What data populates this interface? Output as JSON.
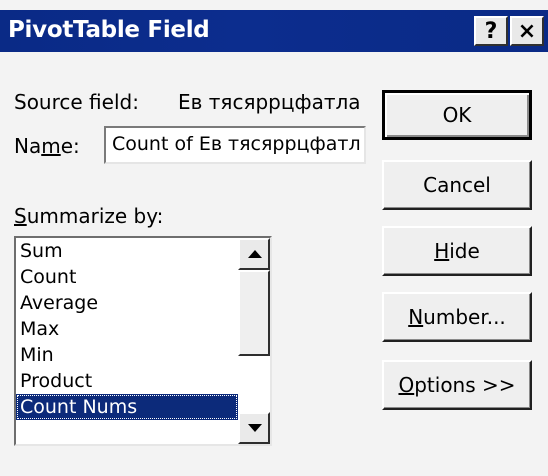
{
  "window": {
    "title": "PivotTable Field",
    "help_label": "?",
    "close_label": "×"
  },
  "source_field": {
    "label": "Source field:",
    "value": "Ев тясяррцфатла"
  },
  "name_field": {
    "label_pre": "Na",
    "label_u": "m",
    "label_post": "e:",
    "value": "Count of Ев тясяррцфатл"
  },
  "summarize": {
    "label_u": "S",
    "label_post": "ummarize by:",
    "items": [
      "Sum",
      "Count",
      "Average",
      "Max",
      "Min",
      "Product",
      "Count Nums"
    ],
    "selected": "Count Nums"
  },
  "buttons": {
    "ok": "OK",
    "cancel": "Cancel",
    "hide_u": "H",
    "hide_post": "ide",
    "number_u": "N",
    "number_post": "umber...",
    "options_u": "O",
    "options_post": "ptions >>"
  }
}
